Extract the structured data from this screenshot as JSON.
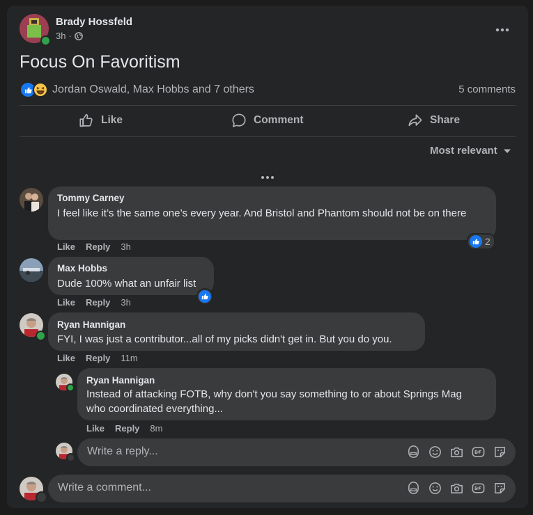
{
  "post": {
    "author": "Brady Hossfeld",
    "time": "3h",
    "separator": "·",
    "title": "Focus On Favoritism",
    "reactions_text": "Jordan Oswald, Max Hobbs and 7 others",
    "comments_count": "5 comments"
  },
  "actions": {
    "like": "Like",
    "comment": "Comment",
    "share": "Share"
  },
  "sort_label": "Most relevant",
  "comments": [
    {
      "name": "Tommy Carney",
      "text": "I feel like it’s the same one’s every year. And Bristol and Phantom should not be on there",
      "like": "Like",
      "reply": "Reply",
      "time": "3h",
      "reaction_count": "2"
    },
    {
      "name": "Max Hobbs",
      "text": "Dude 100% what an unfair list",
      "like": "Like",
      "reply": "Reply",
      "time": "3h"
    },
    {
      "name": "Ryan Hannigan",
      "text": "FYI, I was just a contributor...all of my picks didn't get in. But you do you.",
      "like": "Like",
      "reply": "Reply",
      "time": "11m"
    }
  ],
  "reply": {
    "name": "Ryan Hannigan",
    "text": "Instead of attacking FOTB, why don't you say something to or about Springs Mag who coordinated everything...",
    "like": "Like",
    "reply": "Reply",
    "time": "8m"
  },
  "reply_input": {
    "placeholder": "Write a reply..."
  },
  "comment_input": {
    "placeholder": "Write a comment..."
  },
  "icons": [
    "more-icon",
    "globe-icon",
    "like-reaction-icon",
    "haha-reaction-icon",
    "thumbs-up-icon",
    "comment-icon",
    "share-icon",
    "caret-down-icon",
    "avatar-sticker-icon",
    "emoji-icon",
    "camera-icon",
    "gif-icon",
    "sticker-icon"
  ],
  "colors": {
    "background": "#1c1c1d",
    "card": "#242526",
    "bubble": "#3a3b3c",
    "accent": "#1877f2",
    "online": "#31a24c"
  }
}
